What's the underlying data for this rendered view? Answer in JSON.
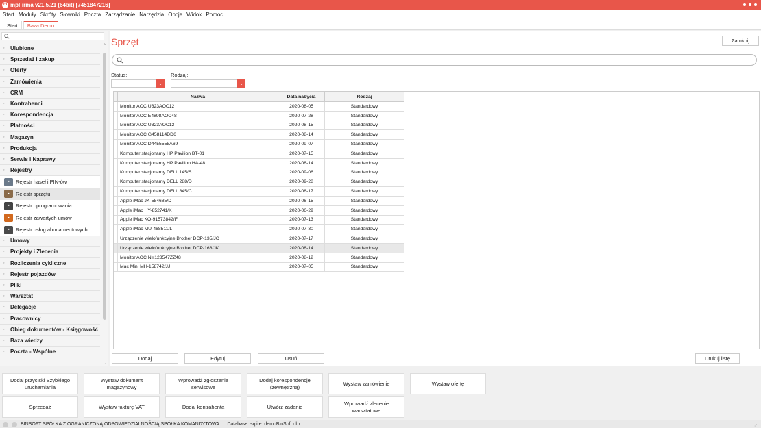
{
  "window": {
    "title": "mpFirma v21.5.21 (64bit) [7451847216]",
    "app_icon": "mp-logo-icon"
  },
  "menu": [
    "Start",
    "Moduły",
    "Skróty",
    "Słowniki",
    "Poczta",
    "Zarządzanie",
    "Narzędzia",
    "Opcje",
    "Widok",
    "Pomoc"
  ],
  "tabs": [
    {
      "label": "Start",
      "active": false
    },
    {
      "label": "Baza Demo",
      "active": true
    }
  ],
  "sidebar": {
    "search_placeholder": "",
    "groups_top": [
      "Ulubione",
      "Sprzedaż i zakup",
      "Oferty",
      "Zamówienia",
      "CRM",
      "Kontrahenci",
      "Korespondencja",
      "Płatności",
      "Magazyn",
      "Produkcja",
      "Serwis i Naprawy",
      "Rejestry"
    ],
    "sub_items": [
      {
        "label": "Rejestr haseł i PIN-ów",
        "icon": "key-register-icon",
        "color": "#6b7a8a",
        "active": false
      },
      {
        "label": "Rejestr sprzętu",
        "icon": "hardware-register-icon",
        "color": "#8a6b4a",
        "active": true
      },
      {
        "label": "Rejestr oprogramowania",
        "icon": "software-register-icon",
        "color": "#444444",
        "active": false
      },
      {
        "label": "Rejestr zawartych umów",
        "icon": "contract-register-icon",
        "color": "#d2691e",
        "active": false
      },
      {
        "label": "Rejestr usług abonamentowych",
        "icon": "subscription-register-icon",
        "color": "#4a4a4a",
        "active": false
      }
    ],
    "groups_bottom": [
      "Umowy",
      "Projekty i Zlecenia",
      "Rozliczenia cykliczne",
      "Rejestr pojazdów",
      "Pliki",
      "Warsztat",
      "Delegacje",
      "Pracownicy",
      "Obieg dokumentów - Księgowość",
      "Baza wiedzy",
      "Poczta - Wspólne"
    ]
  },
  "main": {
    "title": "Sprzęt",
    "close_label": "Zamknij",
    "search_placeholder": "",
    "filters": {
      "status_label": "Status:",
      "status_value": "",
      "type_label": "Rodzaj:",
      "type_value": ""
    },
    "table": {
      "columns": [
        "Nazwa",
        "Data nabycia",
        "Rodzaj"
      ],
      "rows": [
        [
          "Monitor AOC U323AOC12",
          "2020-08-05",
          "Standardowy"
        ],
        [
          "Monitor AOC E4898AOC48",
          "2020-07-28",
          "Standardowy"
        ],
        [
          "Monitor AOC U323AOC12",
          "2020-08-15",
          "Standardowy"
        ],
        [
          "Monitor AOC G458114DD6",
          "2020-08-14",
          "Standardowy"
        ],
        [
          "Monitor AOC D4455558A69",
          "2020-09-07",
          "Standardowy"
        ],
        [
          "Komputer stacjonarny HP Pavilion  BT-01",
          "2020-07-15",
          "Standardowy"
        ],
        [
          "Komputer stacjonarny HP Pavilion HA-48",
          "2020-08-14",
          "Standardowy"
        ],
        [
          "Komputer stacjonarny DELL 145/S",
          "2020-09-06",
          "Standardowy"
        ],
        [
          "Komputer stacjonarny DELL 288/D",
          "2020-09-28",
          "Standardowy"
        ],
        [
          "Komputer stacjonarny DELL 845/C",
          "2020-08-17",
          "Standardowy"
        ],
        [
          "Apple iMac JK-584685/D",
          "2020-06-15",
          "Standardowy"
        ],
        [
          "Apple iMac HY-852741/K",
          "2020-06-29",
          "Standardowy"
        ],
        [
          "Apple iMac KO-91573842/F",
          "2020-07-13",
          "Standardowy"
        ],
        [
          "Apple iMac MU-468511/L",
          "2020-07-30",
          "Standardowy"
        ],
        [
          "Urządzenie wielofunkcyjne Brother  DCP-135/JC",
          "2020-07-17",
          "Standardowy"
        ],
        [
          "Urządzenie wielofunkcyjne Brother DCP-168/JK",
          "2020-08-14",
          "Standardowy"
        ],
        [
          "Monitor AOC NY123547ZZ48",
          "2020-08-12",
          "Standardowy"
        ],
        [
          "Mac Mini MH-158742/JJ",
          "2020-07-05",
          "Standardowy"
        ]
      ],
      "selected_row": 15
    },
    "buttons": {
      "add": "Dodaj",
      "edit": "Edytuj",
      "delete": "Usuń",
      "print": "Drukuj listę"
    }
  },
  "quick_actions": [
    [
      "Dodaj przyciski Szybkiego uruchamiania",
      "Wystaw dokument magazynowy",
      "Wprowadź zgłoszenie serwisowe",
      "Dodaj korespondencję (zewnętrzną)",
      "Wystaw zamówienie",
      "Wystaw ofertę"
    ],
    [
      "Sprzedaż",
      "Wystaw fakturę VAT",
      "Dodaj kontrahenta",
      "Utwórz zadanie",
      "Wprowadź zlecenie warsztatowe"
    ]
  ],
  "status": {
    "text": "BINSOFT SPÓŁKA Z OGRANICZONĄ ODPOWIEDZIALNOŚCIĄ SPÓŁKA KOMANDYTOWA :... Database: sqlite::demoBinSoft.dbx"
  },
  "colors": {
    "accent": "#e8564a"
  }
}
